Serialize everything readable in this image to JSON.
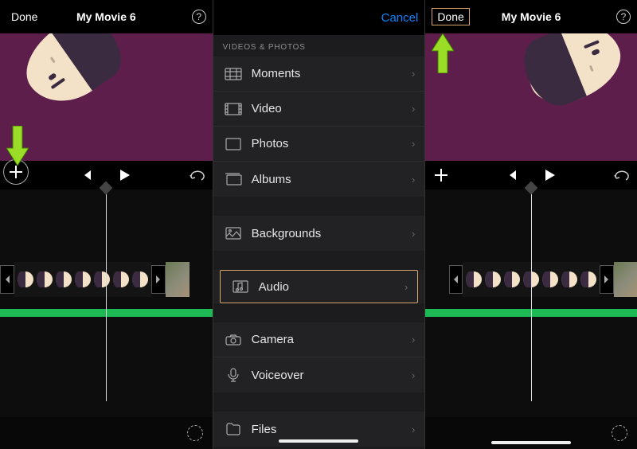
{
  "left_panel": {
    "done_label": "Done",
    "title": "My Movie 6"
  },
  "right_panel": {
    "done_label": "Done",
    "title": "My Movie 6"
  },
  "picker": {
    "cancel_label": "Cancel",
    "section_header": "Videos & Photos",
    "items": {
      "moments": "Moments",
      "video": "Video",
      "photos": "Photos",
      "albums": "Albums",
      "backgrounds": "Backgrounds",
      "audio": "Audio",
      "camera": "Camera",
      "voiceover": "Voiceover",
      "files": "Files"
    }
  },
  "colors": {
    "accent_blue": "#0a84ff",
    "highlight": "#d9a56b",
    "arrow_green": "#9bdc27",
    "audio_green": "#1db954"
  }
}
